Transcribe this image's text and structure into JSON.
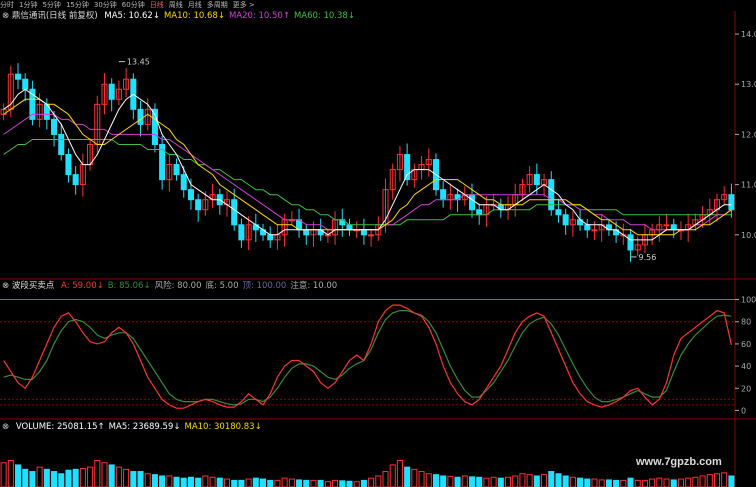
{
  "toolbar": {
    "items": [
      "分时",
      "1分钟",
      "5分钟",
      "15分钟",
      "30分钟",
      "60分钟",
      "日线",
      "周线",
      "月线",
      "多周期",
      "更多 >"
    ],
    "active_index": 6,
    "icon": "chart-icon"
  },
  "colors": {
    "up": "#ff3232",
    "down": "#20e0ff",
    "ma5": "#ffffff",
    "ma10": "#ffd700",
    "ma20": "#d040d0",
    "ma60": "#40c040",
    "lineA": "#ff3232",
    "lineB": "#3a8a3a",
    "grid": "#8b0000",
    "hline": "#6a6a9a"
  },
  "chart_data": [
    {
      "type": "candlestick",
      "panel": "price",
      "title_prefix": "⊗",
      "title": "鼎信通讯(日线 前复权)",
      "legend": [
        {
          "name": "MA5",
          "value": "10.62",
          "arrow": "↓",
          "color": "#ffffff"
        },
        {
          "name": "MA10",
          "value": "10.68",
          "arrow": "↓",
          "color": "#ffd700"
        },
        {
          "name": "MA20",
          "value": "10.50",
          "arrow": "↑",
          "color": "#d040d0"
        },
        {
          "name": "MA60",
          "value": "10.38",
          "arrow": "↓",
          "color": "#40c040"
        }
      ],
      "y_ticks": [
        14,
        13,
        12,
        11,
        10
      ],
      "ylim": [
        9.2,
        14.2
      ],
      "annotations": [
        {
          "text": "13.45",
          "price": 13.45,
          "index": 16
        },
        {
          "text": "9.56",
          "price": 9.56,
          "index": 87
        }
      ],
      "close": [
        12.5,
        13.2,
        13.1,
        12.9,
        12.3,
        12.6,
        12.3,
        12.0,
        11.6,
        11.2,
        11.0,
        11.4,
        11.8,
        12.6,
        13.0,
        12.7,
        12.9,
        13.1,
        12.5,
        12.2,
        12.5,
        11.8,
        11.1,
        11.4,
        11.2,
        10.9,
        10.7,
        10.5,
        10.7,
        10.8,
        10.6,
        10.7,
        10.2,
        9.9,
        10.2,
        10.1,
        10.0,
        9.9,
        10.0,
        10.3,
        10.3,
        10.1,
        10.0,
        10.1,
        10.0,
        10.0,
        10.3,
        10.2,
        10.1,
        10.1,
        10.0,
        10.0,
        10.2,
        10.9,
        11.3,
        11.6,
        11.1,
        11.3,
        11.4,
        11.5,
        10.9,
        10.7,
        10.8,
        10.7,
        10.8,
        10.5,
        10.4,
        10.6,
        10.6,
        10.5,
        10.6,
        10.8,
        11.0,
        11.2,
        11.0,
        11.1,
        10.5,
        10.4,
        10.2,
        10.3,
        10.2,
        10.1,
        10.1,
        10.2,
        10.1,
        10.0,
        10.0,
        9.7,
        9.8,
        10.0,
        10.1,
        10.2,
        10.2,
        10.1,
        10.1,
        10.2,
        10.3,
        10.4,
        10.5,
        10.7,
        10.8,
        10.5
      ],
      "ma5": [
        12.5,
        12.6,
        12.8,
        12.9,
        12.8,
        12.7,
        12.6,
        12.4,
        12.2,
        11.9,
        11.6,
        11.4,
        11.4,
        11.6,
        11.9,
        12.2,
        12.5,
        12.7,
        12.8,
        12.7,
        12.6,
        12.4,
        12.0,
        11.8,
        11.6,
        11.3,
        11.0,
        10.9,
        10.8,
        10.7,
        10.7,
        10.6,
        10.5,
        10.4,
        10.3,
        10.2,
        10.1,
        10.0,
        10.0,
        10.1,
        10.1,
        10.1,
        10.1,
        10.1,
        10.1,
        10.0,
        10.1,
        10.1,
        10.1,
        10.1,
        10.1,
        10.1,
        10.1,
        10.3,
        10.6,
        10.9,
        11.2,
        11.3,
        11.3,
        11.3,
        11.2,
        11.1,
        11.0,
        10.9,
        10.8,
        10.7,
        10.6,
        10.6,
        10.6,
        10.5,
        10.5,
        10.6,
        10.7,
        10.8,
        10.9,
        11.0,
        10.9,
        10.8,
        10.6,
        10.5,
        10.3,
        10.2,
        10.2,
        10.2,
        10.1,
        10.1,
        10.0,
        9.9,
        9.9,
        9.9,
        9.9,
        10.0,
        10.1,
        10.1,
        10.1,
        10.1,
        10.2,
        10.3,
        10.4,
        10.5,
        10.6,
        10.6
      ],
      "ma10": [
        12.4,
        12.5,
        12.6,
        12.7,
        12.7,
        12.7,
        12.6,
        12.6,
        12.5,
        12.4,
        12.2,
        12.0,
        11.9,
        11.8,
        11.8,
        11.9,
        12.0,
        12.1,
        12.2,
        12.3,
        12.4,
        12.3,
        12.2,
        12.1,
        11.9,
        11.8,
        11.6,
        11.4,
        11.3,
        11.2,
        11.0,
        10.9,
        10.8,
        10.7,
        10.6,
        10.5,
        10.4,
        10.3,
        10.2,
        10.2,
        10.2,
        10.1,
        10.1,
        10.1,
        10.1,
        10.1,
        10.1,
        10.1,
        10.1,
        10.1,
        10.1,
        10.1,
        10.1,
        10.2,
        10.3,
        10.5,
        10.6,
        10.8,
        10.9,
        11.0,
        11.1,
        11.1,
        11.1,
        11.1,
        11.0,
        10.9,
        10.8,
        10.7,
        10.7,
        10.6,
        10.6,
        10.6,
        10.6,
        10.7,
        10.7,
        10.7,
        10.7,
        10.7,
        10.7,
        10.6,
        10.6,
        10.5,
        10.4,
        10.3,
        10.3,
        10.2,
        10.1,
        10.1,
        10.0,
        10.0,
        10.0,
        10.0,
        10.0,
        10.0,
        10.1,
        10.1,
        10.1,
        10.2,
        10.2,
        10.3,
        10.4,
        10.5
      ],
      "ma20": [
        12.0,
        12.1,
        12.2,
        12.3,
        12.4,
        12.4,
        12.4,
        12.4,
        12.3,
        12.3,
        12.2,
        12.2,
        12.1,
        12.1,
        12.1,
        12.0,
        12.0,
        12.0,
        12.0,
        12.0,
        12.0,
        12.0,
        11.9,
        11.9,
        11.8,
        11.7,
        11.6,
        11.5,
        11.4,
        11.3,
        11.2,
        11.1,
        11.0,
        10.9,
        10.8,
        10.7,
        10.6,
        10.5,
        10.4,
        10.3,
        10.3,
        10.3,
        10.2,
        10.2,
        10.2,
        10.1,
        10.1,
        10.1,
        10.1,
        10.1,
        10.1,
        10.1,
        10.1,
        10.2,
        10.2,
        10.3,
        10.4,
        10.5,
        10.6,
        10.6,
        10.7,
        10.7,
        10.7,
        10.7,
        10.8,
        10.8,
        10.8,
        10.8,
        10.8,
        10.8,
        10.8,
        10.8,
        10.8,
        10.8,
        10.8,
        10.8,
        10.7,
        10.7,
        10.6,
        10.6,
        10.5,
        10.5,
        10.4,
        10.4,
        10.3,
        10.3,
        10.3,
        10.2,
        10.2,
        10.2,
        10.1,
        10.1,
        10.1,
        10.1,
        10.1,
        10.1,
        10.2,
        10.2,
        10.3,
        10.4,
        10.4,
        10.5
      ],
      "ma60": [
        11.6,
        11.7,
        11.8,
        11.8,
        11.9,
        11.9,
        11.9,
        11.9,
        11.9,
        11.9,
        11.9,
        11.9,
        11.9,
        11.9,
        11.9,
        11.9,
        11.8,
        11.8,
        11.8,
        11.8,
        11.7,
        11.7,
        11.7,
        11.6,
        11.6,
        11.5,
        11.5,
        11.4,
        11.4,
        11.3,
        11.3,
        11.2,
        11.1,
        11.1,
        11.0,
        10.9,
        10.9,
        10.8,
        10.8,
        10.7,
        10.6,
        10.6,
        10.5,
        10.5,
        10.4,
        10.4,
        10.3,
        10.3,
        10.2,
        10.2,
        10.2,
        10.2,
        10.2,
        10.2,
        10.2,
        10.2,
        10.3,
        10.3,
        10.3,
        10.3,
        10.3,
        10.3,
        10.4,
        10.4,
        10.4,
        10.4,
        10.4,
        10.4,
        10.5,
        10.5,
        10.5,
        10.5,
        10.5,
        10.5,
        10.6,
        10.6,
        10.6,
        10.6,
        10.6,
        10.6,
        10.6,
        10.5,
        10.5,
        10.5,
        10.5,
        10.5,
        10.4,
        10.4,
        10.4,
        10.4,
        10.4,
        10.4,
        10.4,
        10.4,
        10.4,
        10.4,
        10.4,
        10.4,
        10.4,
        10.4,
        10.4,
        10.4
      ]
    },
    {
      "type": "line",
      "panel": "indicator",
      "title_prefix": "⊗",
      "title": "波段买卖点",
      "legend": [
        {
          "name": "A",
          "value": "59.00",
          "arrow": "↓",
          "color": "#ff3232"
        },
        {
          "name": "B",
          "value": "85.06",
          "arrow": "↓",
          "color": "#3a8a3a"
        },
        {
          "name": "风险",
          "value": "80.00",
          "arrow": "",
          "color": "#aaaaaa"
        },
        {
          "name": "底",
          "value": "5.00",
          "arrow": "",
          "color": "#aaaaaa"
        },
        {
          "name": "顶",
          "value": "100.00",
          "arrow": "",
          "color": "#6a6a9a"
        },
        {
          "name": "注意",
          "value": "10.00",
          "arrow": "",
          "color": "#aaaaaa"
        }
      ],
      "y_ticks": [
        100,
        80,
        60,
        40,
        20,
        0
      ],
      "ylim": [
        -5,
        105
      ],
      "hlines": [
        80,
        5,
        10
      ],
      "series": [
        {
          "name": "A",
          "values": [
            45,
            35,
            25,
            20,
            30,
            45,
            60,
            75,
            85,
            88,
            80,
            70,
            62,
            60,
            62,
            70,
            75,
            70,
            60,
            45,
            30,
            20,
            10,
            5,
            2,
            2,
            5,
            8,
            10,
            8,
            5,
            3,
            3,
            8,
            15,
            10,
            5,
            15,
            30,
            40,
            45,
            45,
            40,
            35,
            25,
            20,
            25,
            35,
            45,
            50,
            45,
            60,
            80,
            90,
            95,
            95,
            92,
            88,
            85,
            75,
            60,
            40,
            25,
            15,
            8,
            5,
            10,
            20,
            30,
            40,
            55,
            70,
            80,
            85,
            88,
            85,
            70,
            55,
            40,
            25,
            15,
            8,
            5,
            3,
            5,
            8,
            12,
            18,
            20,
            12,
            5,
            10,
            25,
            50,
            65,
            70,
            75,
            80,
            85,
            90,
            88,
            59
          ]
        },
        {
          "name": "B",
          "values": [
            30,
            32,
            30,
            28,
            28,
            35,
            45,
            60,
            72,
            80,
            82,
            80,
            75,
            68,
            65,
            68,
            70,
            70,
            65,
            55,
            45,
            35,
            25,
            15,
            10,
            8,
            8,
            8,
            10,
            10,
            8,
            6,
            5,
            6,
            10,
            10,
            8,
            12,
            20,
            30,
            38,
            42,
            42,
            40,
            35,
            30,
            28,
            32,
            38,
            42,
            45,
            55,
            70,
            82,
            88,
            90,
            90,
            88,
            86,
            80,
            70,
            55,
            40,
            28,
            18,
            12,
            12,
            18,
            25,
            35,
            45,
            58,
            70,
            78,
            82,
            84,
            78,
            68,
            55,
            42,
            30,
            20,
            12,
            8,
            8,
            10,
            12,
            15,
            18,
            15,
            12,
            12,
            18,
            35,
            50,
            60,
            68,
            74,
            80,
            85,
            86,
            85
          ]
        }
      ]
    },
    {
      "type": "bar",
      "panel": "volume",
      "title_prefix": "⊗",
      "title": "VOLUME",
      "legend": [
        {
          "name": "VOLUME",
          "value": "25081.15",
          "arrow": "↑",
          "color": "#ffffff"
        },
        {
          "name": "MA5",
          "value": "23689.59",
          "arrow": "↓",
          "color": "#ffffff"
        },
        {
          "name": "MA10",
          "value": "30180.83",
          "arrow": "↓",
          "color": "#ffd700"
        }
      ],
      "values": [
        55,
        60,
        50,
        40,
        35,
        45,
        40,
        35,
        30,
        38,
        40,
        42,
        45,
        60,
        55,
        50,
        45,
        40,
        35,
        35,
        30,
        28,
        25,
        25,
        22,
        20,
        22,
        20,
        25,
        22,
        20,
        18,
        15,
        15,
        18,
        20,
        18,
        15,
        15,
        20,
        18,
        16,
        15,
        15,
        15,
        12,
        15,
        14,
        13,
        12,
        15,
        20,
        25,
        35,
        50,
        60,
        45,
        40,
        35,
        30,
        28,
        25,
        24,
        22,
        25,
        23,
        22,
        20,
        22,
        20,
        22,
        25,
        30,
        28,
        25,
        28,
        35,
        30,
        25,
        22,
        20,
        18,
        18,
        16,
        16,
        15,
        15,
        20,
        15,
        15,
        18,
        20,
        18,
        16,
        18,
        20,
        22,
        25,
        28,
        30,
        32,
        25
      ],
      "ylim": [
        0,
        120
      ]
    }
  ]
}
